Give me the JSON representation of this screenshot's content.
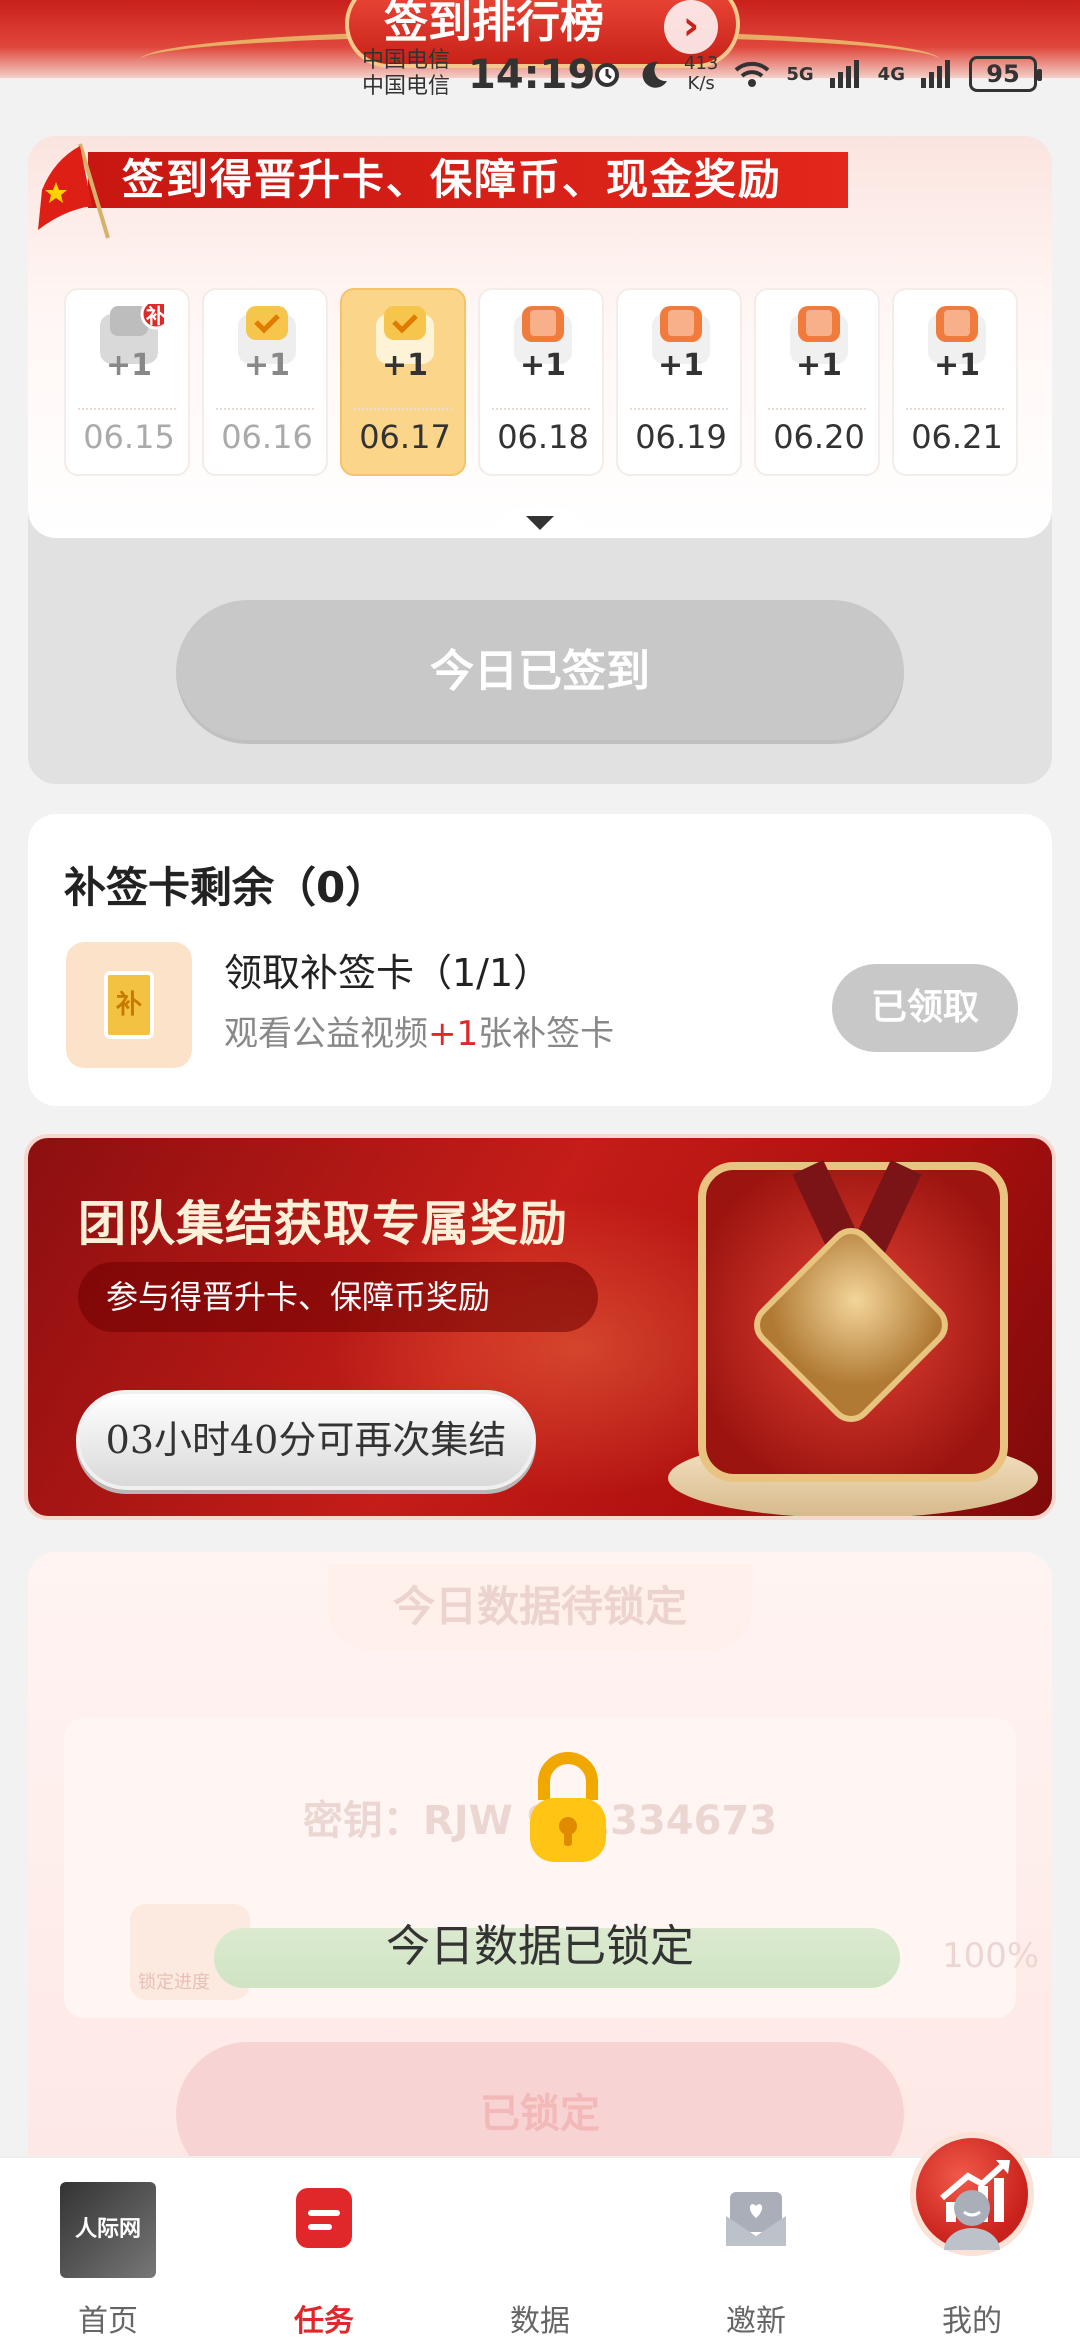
{
  "header": {
    "rank_label": "签到排行榜",
    "rank_chevron": "›"
  },
  "status_bar": {
    "carrier_1": "中国电信",
    "carrier_2": "中国电信",
    "time": "14:19",
    "net_speed": "413\nK/s",
    "sig_5g": "5G",
    "sig_4g": "4G",
    "battery": "95"
  },
  "checkin": {
    "banner": "签到得晋升卡、保障币、现金奖励",
    "days": [
      {
        "date": "06.15",
        "plus": "+1",
        "state": "makeup",
        "badge": "补"
      },
      {
        "date": "06.16",
        "plus": "+1",
        "state": "done"
      },
      {
        "date": "06.17",
        "plus": "+1",
        "state": "today"
      },
      {
        "date": "06.18",
        "plus": "+1",
        "state": "future",
        "card": "晋升"
      },
      {
        "date": "06.19",
        "plus": "+1",
        "state": "future",
        "card": "晋升"
      },
      {
        "date": "06.20",
        "plus": "+1",
        "state": "future",
        "card": "晋升"
      },
      {
        "date": "06.21",
        "plus": "+1",
        "state": "future",
        "card": "晋升"
      }
    ],
    "signed_button": "今日已签到"
  },
  "makeup": {
    "title": "补签卡剩余（0）",
    "icon_text": "补",
    "task_name": "领取补签卡（1/1）",
    "desc_prefix": "观看公益视频",
    "desc_highlight": "+1",
    "desc_suffix": "张补签卡",
    "claimed_button": "已领取"
  },
  "team": {
    "title": "团队集结获取专属奖励",
    "subtitle": "参与得晋升卡、保障币奖励",
    "countdown": "03小时40分可再次集结"
  },
  "lock": {
    "header": "今日数据待锁定",
    "key_text": "密钥：RJW 961334673",
    "progress_label": "锁定进度",
    "progress_pct": "100%",
    "progress_value": 1.0,
    "status": "今日数据已锁定",
    "locked_button": "已锁定"
  },
  "nav": {
    "items": [
      {
        "label": "首页",
        "icon": "home-thumbnail-icon",
        "active": false
      },
      {
        "label": "任务",
        "icon": "task-icon",
        "active": true
      },
      {
        "label": "数据",
        "icon": "chart-growth-icon",
        "active": false
      },
      {
        "label": "邀新",
        "icon": "invite-envelope-icon",
        "active": false
      },
      {
        "label": "我的",
        "icon": "profile-icon",
        "active": false
      }
    ],
    "home_thumb_text": "人际网"
  },
  "colors": {
    "brand_red": "#e0282a",
    "gold": "#f5c36a",
    "disabled_gray": "#c9c8c8"
  }
}
